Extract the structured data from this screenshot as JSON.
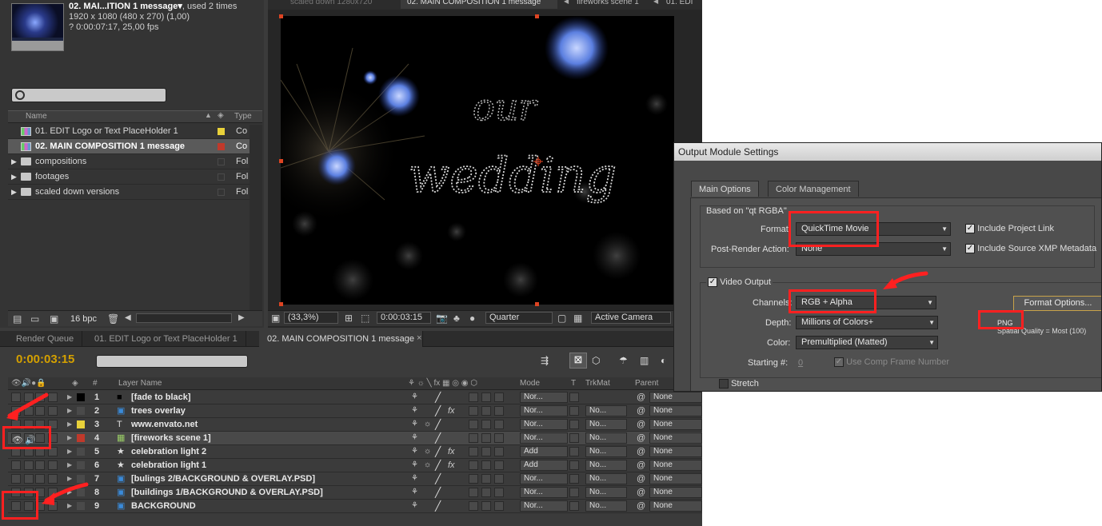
{
  "project": {
    "name": "02. MAI...ITION 1 message",
    "used": ", used 2 times",
    "dims": "1920 x 1080  (480 x 270) (1,00)",
    "duration": "? 0:00:07:17, 25,00 fps",
    "col_name": "Name",
    "col_type": "Type",
    "items": [
      {
        "name": "01.  EDIT Logo or Text PlaceHolder 1",
        "type": "Co",
        "kind": "comp",
        "color": "#e8d13a"
      },
      {
        "name": "02. MAIN COMPOSITION 1 message",
        "type": "Co",
        "kind": "comp",
        "color": "#c0392b"
      },
      {
        "name": "compositions",
        "type": "Fol",
        "kind": "folder",
        "color": ""
      },
      {
        "name": "footages",
        "type": "Fol",
        "kind": "folder",
        "color": ""
      },
      {
        "name": "scaled down versions",
        "type": "Fol",
        "kind": "folder",
        "color": ""
      }
    ],
    "bpc": "16 bpc"
  },
  "viewer": {
    "tabs": [
      "scaled down 1280x720",
      "02. MAIN COMPOSITION 1 message",
      "fireworks scene 1",
      "01.  EDI"
    ],
    "zoom": "(33,3%)",
    "time": "0:00:03:15",
    "resolution": "Quarter",
    "camera": "Active Camera",
    "canvas_text": "our wedding"
  },
  "timeline": {
    "tabs": [
      "Render Queue",
      "01.  EDIT Logo or Text PlaceHolder 1",
      "02. MAIN COMPOSITION 1 message"
    ],
    "current_time": "0:00:03:15",
    "headers": {
      "num": "#",
      "layer_name": "Layer Name",
      "mode": "Mode",
      "t": "T",
      "trkmat": "TrkMat",
      "parent": "Parent"
    },
    "layers": [
      {
        "num": "1",
        "name": "[fade to black]",
        "color": "#000000",
        "mode": "Nor...",
        "trkmat": "",
        "parent": "None",
        "fx": false,
        "icon": "solid"
      },
      {
        "num": "2",
        "name": "trees overlay",
        "color": "#4a4a4a",
        "mode": "Nor...",
        "trkmat": "No...",
        "parent": "None",
        "fx": true,
        "icon": "footage"
      },
      {
        "num": "3",
        "name": "www.envato.net",
        "color": "#e8d13a",
        "mode": "Nor...",
        "trkmat": "No...",
        "parent": "None",
        "fx": false,
        "icon": "text"
      },
      {
        "num": "4",
        "name": "[fireworks scene 1]",
        "color": "#c0392b",
        "mode": "Nor...",
        "trkmat": "No...",
        "parent": "None",
        "fx": false,
        "icon": "comp"
      },
      {
        "num": "5",
        "name": "celebration light 2",
        "color": "#4a4a4a",
        "mode": "Add",
        "trkmat": "No...",
        "parent": "None",
        "fx": true,
        "icon": "star"
      },
      {
        "num": "6",
        "name": "celebration light 1",
        "color": "#4a4a4a",
        "mode": "Add",
        "trkmat": "No...",
        "parent": "None",
        "fx": true,
        "icon": "star"
      },
      {
        "num": "7",
        "name": "[bulings 2/BACKGROUND & OVERLAY.PSD]",
        "color": "#4a4a4a",
        "mode": "Nor...",
        "trkmat": "No...",
        "parent": "None",
        "fx": false,
        "icon": "footage"
      },
      {
        "num": "8",
        "name": "[buildings 1/BACKGROUND & OVERLAY.PSD]",
        "color": "#4a4a4a",
        "mode": "Nor...",
        "trkmat": "No...",
        "parent": "None",
        "fx": false,
        "icon": "footage"
      },
      {
        "num": "9",
        "name": "BACKGROUND",
        "color": "#4a4a4a",
        "mode": "Nor...",
        "trkmat": "No...",
        "parent": "None",
        "fx": false,
        "icon": "footage"
      }
    ]
  },
  "dialog": {
    "title": "Output Module Settings",
    "tabs": [
      "Main Options",
      "Color Management"
    ],
    "based_on": "Based on \"qt RGBA\"",
    "format_label": "Format:",
    "format_value": "QuickTime Movie",
    "post_render_label": "Post-Render Action:",
    "post_render_value": "None",
    "include_project_link": "Include Project Link",
    "include_xmp": "Include Source XMP Metadata",
    "video_output": "Video Output",
    "channels_label": "Channels:",
    "channels_value": "RGB + Alpha",
    "depth_label": "Depth:",
    "depth_value": "Millions of Colors+",
    "color_label": "Color:",
    "color_value": "Premultiplied (Matted)",
    "starting_label": "Starting #:",
    "starting_value": "0",
    "use_comp_frame": "Use Comp Frame Number",
    "format_options": "Format Options...",
    "codec": "PNG",
    "spatial_quality": "Spatial Quality = Most (100)",
    "stretch": "Stretch"
  },
  "colors": {
    "annotation": "#ff2020",
    "timecode": "#d4a000",
    "accent": "#c8a34a"
  }
}
